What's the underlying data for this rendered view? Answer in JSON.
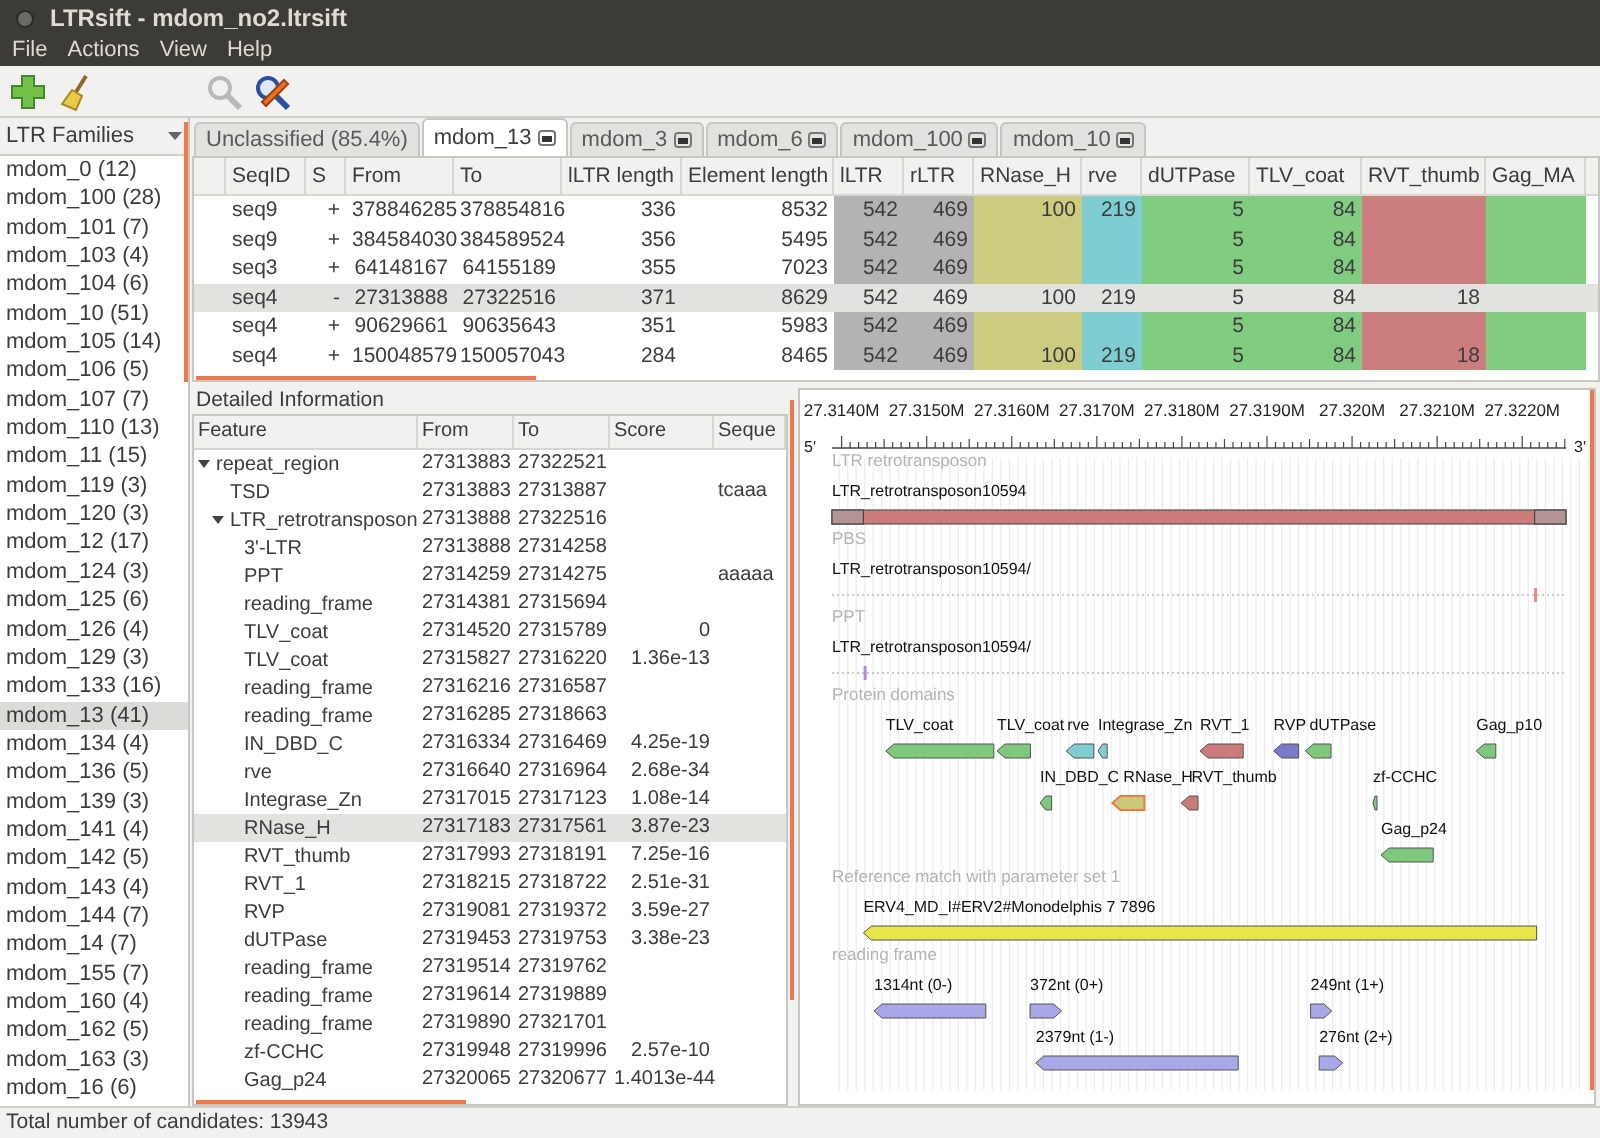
{
  "window": {
    "title": "LTRsift - mdom_no2.ltrsift"
  },
  "menu": [
    "File",
    "Actions",
    "View",
    "Help"
  ],
  "toolbar_groups": [
    [
      {
        "kind": "add",
        "disabled": false
      },
      {
        "kind": "clean",
        "disabled": false
      }
    ],
    [
      {
        "kind": "search",
        "disabled": true
      },
      {
        "kind": "find-edit",
        "disabled": false
      }
    ]
  ],
  "sidebar": {
    "title": "LTR Families",
    "items": [
      {
        "label": "mdom_0 (12)",
        "selected": false
      },
      {
        "label": "mdom_100 (28)",
        "selected": false
      },
      {
        "label": "mdom_101 (7)",
        "selected": false
      },
      {
        "label": "mdom_103 (4)",
        "selected": false
      },
      {
        "label": "mdom_104 (6)",
        "selected": false
      },
      {
        "label": "mdom_10 (51)",
        "selected": false
      },
      {
        "label": "mdom_105 (14)",
        "selected": false
      },
      {
        "label": "mdom_106 (5)",
        "selected": false
      },
      {
        "label": "mdom_107 (7)",
        "selected": false
      },
      {
        "label": "mdom_110 (13)",
        "selected": false
      },
      {
        "label": "mdom_11 (15)",
        "selected": false
      },
      {
        "label": "mdom_119 (3)",
        "selected": false
      },
      {
        "label": "mdom_120 (3)",
        "selected": false
      },
      {
        "label": "mdom_12 (17)",
        "selected": false
      },
      {
        "label": "mdom_124 (3)",
        "selected": false
      },
      {
        "label": "mdom_125 (6)",
        "selected": false
      },
      {
        "label": "mdom_126 (4)",
        "selected": false
      },
      {
        "label": "mdom_129 (3)",
        "selected": false
      },
      {
        "label": "mdom_133 (16)",
        "selected": false
      },
      {
        "label": "mdom_13 (41)",
        "selected": true
      },
      {
        "label": "mdom_134 (4)",
        "selected": false
      },
      {
        "label": "mdom_136 (5)",
        "selected": false
      },
      {
        "label": "mdom_139 (3)",
        "selected": false
      },
      {
        "label": "mdom_141 (4)",
        "selected": false
      },
      {
        "label": "mdom_142 (5)",
        "selected": false
      },
      {
        "label": "mdom_143 (4)",
        "selected": false
      },
      {
        "label": "mdom_144 (7)",
        "selected": false
      },
      {
        "label": "mdom_14 (7)",
        "selected": false
      },
      {
        "label": "mdom_155 (7)",
        "selected": false
      },
      {
        "label": "mdom_160 (4)",
        "selected": false
      },
      {
        "label": "mdom_162 (5)",
        "selected": false
      },
      {
        "label": "mdom_163 (3)",
        "selected": false
      },
      {
        "label": "mdom_16 (6)",
        "selected": false
      }
    ]
  },
  "tabs": [
    {
      "label": "Unclassified (85.4%)",
      "selected": false,
      "closable": false
    },
    {
      "label": "mdom_13",
      "selected": true,
      "closable": true
    },
    {
      "label": "mdom_3",
      "selected": false,
      "closable": true
    },
    {
      "label": "mdom_6",
      "selected": false,
      "closable": true
    },
    {
      "label": "mdom_100",
      "selected": false,
      "closable": true
    },
    {
      "label": "mdom_10",
      "selected": false,
      "closable": true
    }
  ],
  "table": {
    "columns": [
      {
        "label": "SeqID"
      },
      {
        "label": "S"
      },
      {
        "label": "From"
      },
      {
        "label": "To"
      },
      {
        "label": "lLTR length"
      },
      {
        "label": "Element length"
      },
      {
        "label": "lLTR",
        "color": "#b3b3b3"
      },
      {
        "label": "rLTR",
        "color": "#b3b3b3"
      },
      {
        "label": "RNase_H",
        "color": "#cccc80"
      },
      {
        "label": "rve",
        "color": "#7ecdd0"
      },
      {
        "label": "dUTPase",
        "color": "#80cc80"
      },
      {
        "label": "TLV_coat",
        "color": "#80cc80"
      },
      {
        "label": "RVT_thumb",
        "color": "#cc7d7d"
      },
      {
        "label": "Gag_MA",
        "color": "#80cc80"
      }
    ],
    "rows": [
      {
        "selected": false,
        "cells": [
          "seq9",
          "+",
          "378846285",
          "378854816",
          "336",
          "8532",
          "542",
          "469",
          "100",
          "219",
          "5",
          "84",
          "",
          ""
        ]
      },
      {
        "selected": false,
        "cells": [
          "seq9",
          "+",
          "384584030",
          "384589524",
          "356",
          "5495",
          "542",
          "469",
          "",
          "",
          "5",
          "84",
          "",
          ""
        ]
      },
      {
        "selected": false,
        "cells": [
          "seq3",
          "+",
          "64148167",
          "64155189",
          "355",
          "7023",
          "542",
          "469",
          "",
          "",
          "5",
          "84",
          "",
          ""
        ]
      },
      {
        "selected": true,
        "cells": [
          "seq4",
          "-",
          "27313888",
          "27322516",
          "371",
          "8629",
          "542",
          "469",
          "100",
          "219",
          "5",
          "84",
          "18",
          ""
        ]
      },
      {
        "selected": false,
        "cells": [
          "seq4",
          "+",
          "90629661",
          "90635643",
          "351",
          "5983",
          "542",
          "469",
          "",
          "",
          "5",
          "84",
          "",
          ""
        ]
      },
      {
        "selected": false,
        "cells": [
          "seq4",
          "+",
          "150048579",
          "150057043",
          "284",
          "8465",
          "542",
          "469",
          "100",
          "219",
          "5",
          "84",
          "18",
          ""
        ]
      }
    ]
  },
  "details": {
    "title": "Detailed Information",
    "columns": [
      "Feature",
      "From",
      "To",
      "Score",
      "Seque"
    ],
    "rows": [
      {
        "feature": "repeat_region",
        "from": "27313883",
        "to": "27322521",
        "expanded": true,
        "selected": false,
        "children": [
          {
            "feature": "TSD",
            "from": "27313883",
            "to": "27313887",
            "sequence": "tcaaa",
            "selected": false
          },
          {
            "feature": "LTR_retrotransposon",
            "from": "27313888",
            "to": "27322516",
            "expanded": true,
            "selected": false,
            "children": [
              {
                "feature": "3'-LTR",
                "from": "27313888",
                "to": "27314258",
                "selected": false
              },
              {
                "feature": "PPT",
                "from": "27314259",
                "to": "27314275",
                "sequence": "aaaaa",
                "selected": false
              },
              {
                "feature": "reading_frame",
                "from": "27314381",
                "to": "27315694",
                "selected": false
              },
              {
                "feature": "TLV_coat",
                "from": "27314520",
                "to": "27315789",
                "score": "0",
                "selected": false
              },
              {
                "feature": "TLV_coat",
                "from": "27315827",
                "to": "27316220",
                "score": "1.36e-13",
                "selected": false
              },
              {
                "feature": "reading_frame",
                "from": "27316216",
                "to": "27316587",
                "selected": false
              },
              {
                "feature": "reading_frame",
                "from": "27316285",
                "to": "27318663",
                "selected": false
              },
              {
                "feature": "IN_DBD_C",
                "from": "27316334",
                "to": "27316469",
                "score": "4.25e-19",
                "selected": false
              },
              {
                "feature": "rve",
                "from": "27316640",
                "to": "27316964",
                "score": "2.68e-34",
                "selected": false
              },
              {
                "feature": "Integrase_Zn",
                "from": "27317015",
                "to": "27317123",
                "score": "1.08e-14",
                "selected": false
              },
              {
                "feature": "RNase_H",
                "from": "27317183",
                "to": "27317561",
                "score": "3.87e-23",
                "selected": true
              },
              {
                "feature": "RVT_thumb",
                "from": "27317993",
                "to": "27318191",
                "score": "7.25e-16",
                "selected": false
              },
              {
                "feature": "RVT_1",
                "from": "27318215",
                "to": "27318722",
                "score": "2.51e-31",
                "selected": false
              },
              {
                "feature": "RVP",
                "from": "27319081",
                "to": "27319372",
                "score": "3.59e-27",
                "selected": false
              },
              {
                "feature": "dUTPase",
                "from": "27319453",
                "to": "27319753",
                "score": "3.38e-23",
                "selected": false
              },
              {
                "feature": "reading_frame",
                "from": "27319514",
                "to": "27319762",
                "selected": false
              },
              {
                "feature": "reading_frame",
                "from": "27319614",
                "to": "27319889",
                "selected": false
              },
              {
                "feature": "reading_frame",
                "from": "27319890",
                "to": "27321701",
                "selected": false
              },
              {
                "feature": "zf-CCHC",
                "from": "27319948",
                "to": "27319996",
                "score": "2.57e-10",
                "selected": false
              },
              {
                "feature": "Gag_p24",
                "from": "27320065",
                "to": "27320677",
                "score": "1.4013e-44",
                "selected": false
              }
            ]
          }
        ]
      }
    ]
  },
  "viewer": {
    "left_end": "5'",
    "right_end": "3'",
    "ticks": [
      "27.3140M",
      "27.3150M",
      "27.3160M",
      "27.3170M",
      "27.3180M",
      "27.3190M",
      "27.320M",
      "27.3210M",
      "27.3220M"
    ],
    "tracks": [
      {
        "title": "LTR retrotransposon",
        "kind": "element",
        "lanes": [
          [
            {
              "label": "LTR_retrotransposon10594",
              "color": "#cc7a7a"
            }
          ]
        ]
      },
      {
        "title": "PBS",
        "kind": "marker",
        "lanes": [
          [
            {
              "label": "LTR_retrotransposon10594/",
              "color": "#ee8888"
            }
          ]
        ]
      },
      {
        "title": "PPT",
        "kind": "marker",
        "lanes": [
          [
            {
              "label": "LTR_retrotransposon10594/",
              "color": "#aa88ee"
            }
          ]
        ]
      },
      {
        "title": "Protein domains",
        "kind": "domains",
        "lanes": [
          [
            {
              "label": "TLV_coat",
              "reverse": true,
              "color": "#7dc87d",
              "selected": false
            },
            {
              "label": "TLV_coat",
              "reverse": true,
              "color": "#7dc87d",
              "selected": false
            },
            {
              "label": "rve",
              "reverse": true,
              "color": "#7ecdd0",
              "selected": false
            },
            {
              "label": "Integrase_Zn",
              "reverse": true,
              "color": "#7ecdd0",
              "selected": false
            },
            {
              "label": "RVT_1",
              "reverse": true,
              "color": "#cc7a7a",
              "selected": false
            },
            {
              "label": "RVP",
              "reverse": true,
              "color": "#7a7acc",
              "selected": false
            },
            {
              "label": "dUTPase",
              "reverse": true,
              "color": "#7dc87d",
              "selected": false
            },
            {
              "label": "Gag_p10",
              "reverse": true,
              "color": "#7dc87d",
              "selected": false
            }
          ],
          [
            {
              "label": "IN_DBD_C",
              "reverse": true,
              "color": "#7dc87d",
              "selected": false
            },
            {
              "label": "RNase_H",
              "reverse": true,
              "color": "#c9c97a",
              "selected": true
            },
            {
              "label": "RVT_thumb",
              "reverse": true,
              "color": "#cc7a7a",
              "selected": false
            },
            {
              "label": "zf-CCHC",
              "reverse": true,
              "color": "#7dc87d",
              "selected": false
            }
          ],
          [
            {
              "label": "Gag_p24",
              "reverse": true,
              "color": "#7dc87d",
              "selected": false
            }
          ]
        ]
      },
      {
        "title": "Reference match with parameter set 1",
        "kind": "match",
        "lanes": [
          [
            {
              "label": "ERV4_MD_I#ERV2#Monodelphis 7 7896",
              "reverse": true,
              "color": "#e6e64a"
            }
          ]
        ]
      },
      {
        "title": "reading frame",
        "kind": "frames",
        "lanes": [
          [
            {
              "label": "1314nt (0-)",
              "reverse": true,
              "color": "#a8a8e8"
            },
            {
              "label": "372nt (0+)",
              "reverse": false,
              "color": "#a8a8e8"
            },
            {
              "label": "249nt (1+)",
              "reverse": false,
              "color": "#a8a8e8"
            }
          ],
          [
            {
              "label": "2379nt (1-)",
              "reverse": true,
              "color": "#a8a8e8"
            },
            {
              "label": "276nt (2+)",
              "reverse": false,
              "color": "#a8a8e8"
            }
          ]
        ]
      }
    ]
  },
  "status_bar": "Total number of candidates: 13943"
}
